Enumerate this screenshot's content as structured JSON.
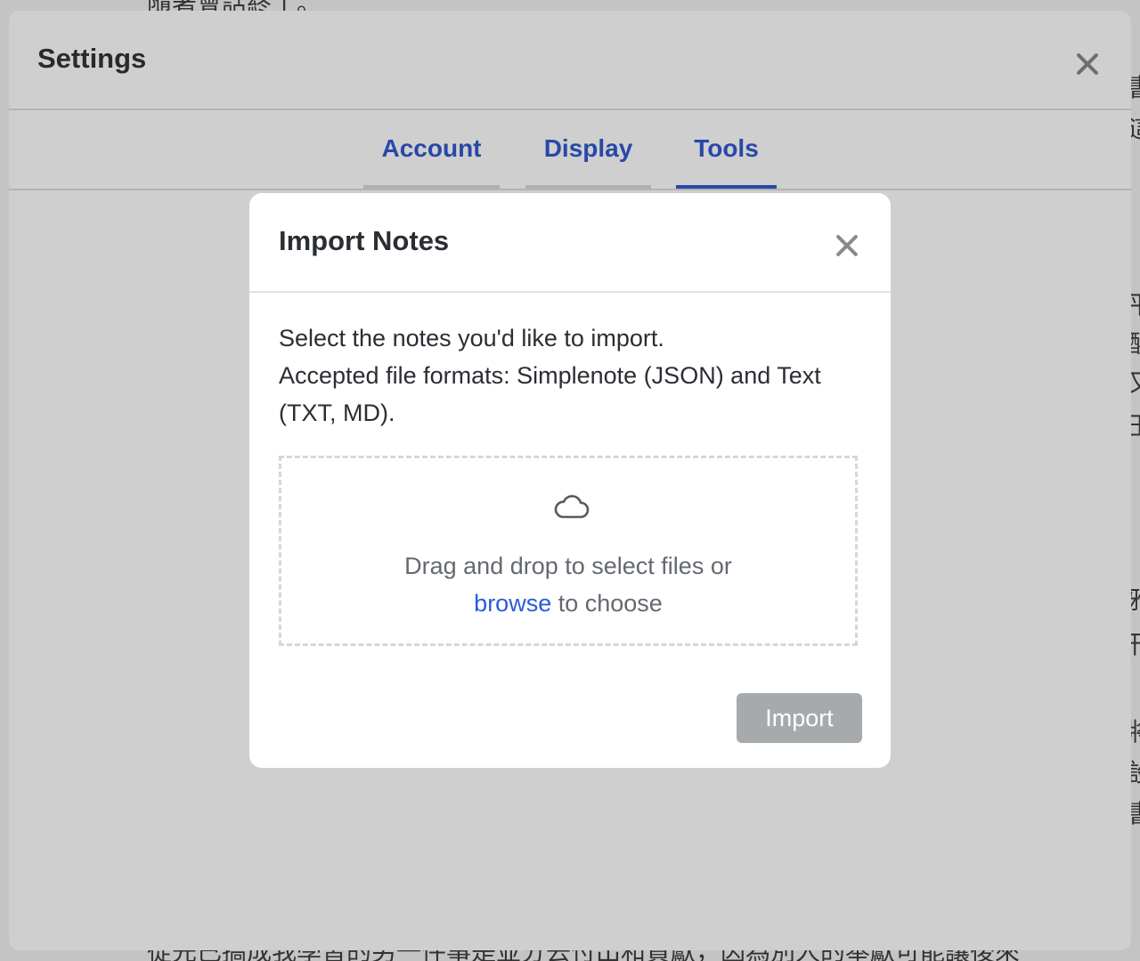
{
  "background": {
    "top_text": "隨著會話終了。",
    "bottom_text": "從先已搞成我學習的另一件事是並分去付出和貢獻，因為別人的奉獻可能讓後來",
    "side_chars": [
      "書",
      "這",
      "平",
      "醒",
      "又",
      "玉",
      "雅",
      "刊",
      "將",
      "設",
      "書"
    ]
  },
  "settings": {
    "title": "Settings",
    "tabs": [
      {
        "label": "Account",
        "active": false
      },
      {
        "label": "Display",
        "active": false
      },
      {
        "label": "Tools",
        "active": true
      }
    ]
  },
  "dialog": {
    "title": "Import Notes",
    "description_line1": "Select the notes you'd like to import.",
    "description_line2": "Accepted file formats: Simplenote (JSON) and Text (TXT, MD).",
    "dropzone": {
      "icon": "cloud-icon",
      "text_prefix": "Drag and drop to select files or",
      "link_text": "browse",
      "text_suffix": " to choose"
    },
    "import_button": "Import",
    "import_button_disabled": true
  },
  "colors": {
    "accent": "#2848a8",
    "link": "#2a5bd7",
    "button_disabled": "#a7aaad",
    "overlay": "#cfcfcf"
  }
}
